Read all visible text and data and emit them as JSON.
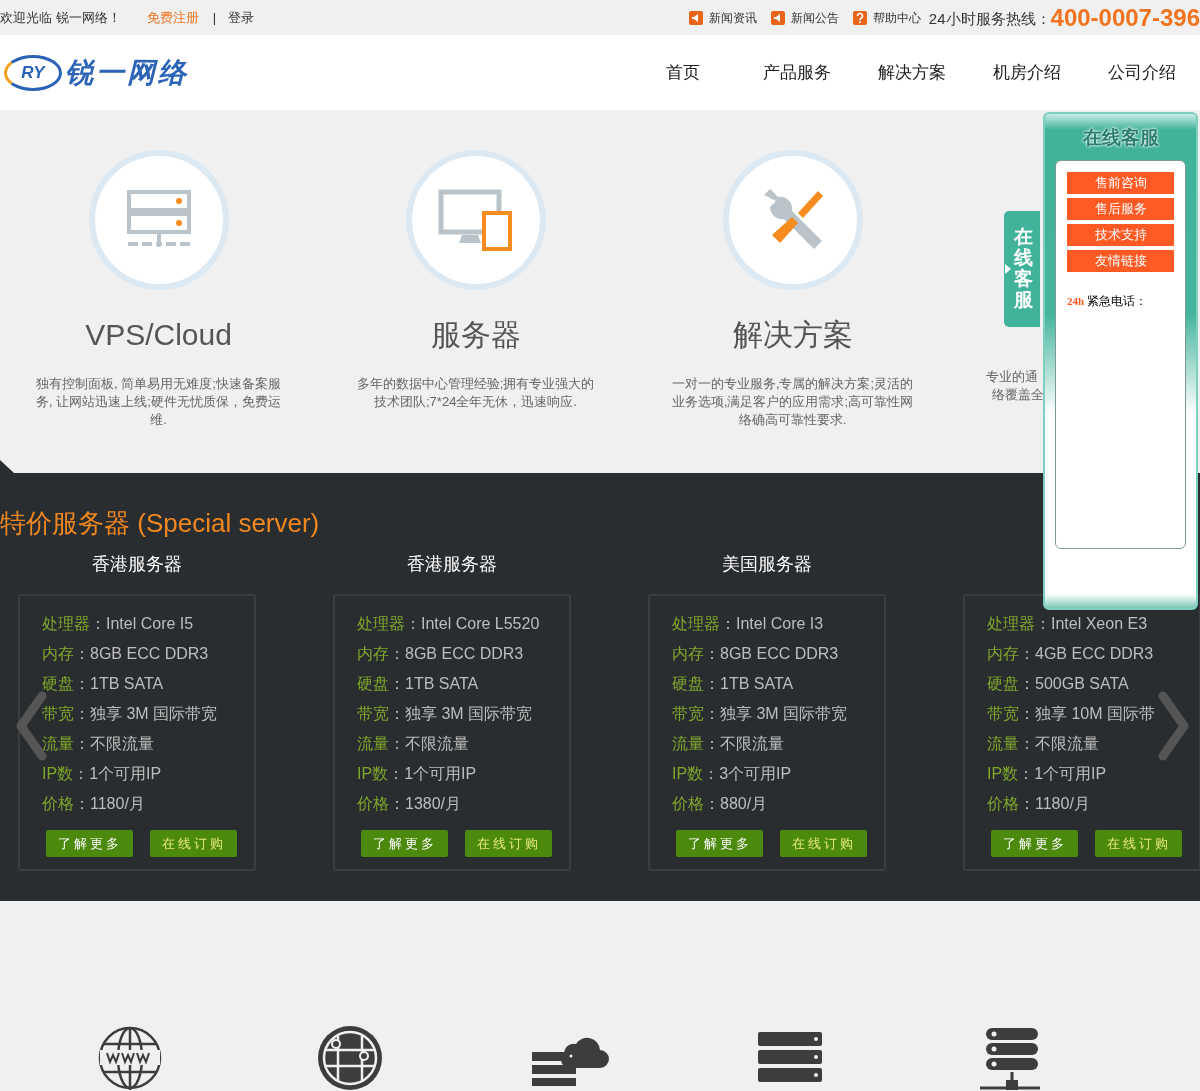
{
  "top_bar": {
    "welcome": "欢迎光临 锐一网络！",
    "register": "免费注册",
    "separator": "|",
    "login": "登录",
    "links": [
      {
        "kind": "news",
        "label": "新闻资讯"
      },
      {
        "kind": "news",
        "label": "新闻公告"
      },
      {
        "kind": "help",
        "label": "帮助中心"
      }
    ],
    "hotline_label": "24小时服务热线：",
    "hotline": "400-0007-396"
  },
  "header": {
    "logo_mark": "RY",
    "logo_text": "锐一网络",
    "nav": [
      "首页",
      "产品服务",
      "解决方案",
      "机房介绍",
      "公司介绍"
    ]
  },
  "features": [
    {
      "kind": "server",
      "title": "VPS/Cloud",
      "description": "独有控制面板, 简单易用无难度;快速备案服务, 让网站迅速上线;硬件无忧质保，免费运维."
    },
    {
      "kind": "devices",
      "title": "服务器",
      "description": "多年的数据中心管理经验;拥有专业强大的技术团队;7*24全年无休，迅速响应."
    },
    {
      "kind": "tools",
      "title": "解决方案",
      "description": "一对一的专业服务,专属的解决方案;灵活的业务选项,满足客户的应用需求;高可靠性网络确高可靠性要求."
    }
  ],
  "feature_fragments": [
    "专业的通",
    "络覆盖全"
  ],
  "special": {
    "title": "特价服务器 (Special server)",
    "separator": "：",
    "servers": [
      {
        "title": "香港服务器",
        "specs": [
          {
            "label": "处理器",
            "value": "Intel Core I5"
          },
          {
            "label": "内存",
            "value": "8GB ECC DDR3"
          },
          {
            "label": "硬盘",
            "value": "1TB SATA"
          },
          {
            "label": "带宽",
            "value": "独享 3M 国际带宽"
          },
          {
            "label": "流量",
            "value": "不限流量"
          },
          {
            "label": "IP数",
            "value": "1个可用IP"
          },
          {
            "label": "价格",
            "value": "1180/月"
          }
        ],
        "buttons": [
          "了解更多",
          "在线订购"
        ]
      },
      {
        "title": "香港服务器",
        "specs": [
          {
            "label": "处理器",
            "value": "Intel Core L5520"
          },
          {
            "label": "内存",
            "value": "8GB ECC DDR3"
          },
          {
            "label": "硬盘",
            "value": "1TB SATA"
          },
          {
            "label": "带宽",
            "value": "独享 3M 国际带宽"
          },
          {
            "label": "流量",
            "value": "不限流量"
          },
          {
            "label": "IP数",
            "value": "1个可用IP"
          },
          {
            "label": "价格",
            "value": "1380/月"
          }
        ],
        "buttons": [
          "了解更多",
          "在线订购"
        ]
      },
      {
        "title": "美国服务器",
        "specs": [
          {
            "label": "处理器",
            "value": "Intel Core I3"
          },
          {
            "label": "内存",
            "value": "8GB ECC DDR3"
          },
          {
            "label": "硬盘",
            "value": "1TB SATA"
          },
          {
            "label": "带宽",
            "value": "独享 3M 国际带宽"
          },
          {
            "label": "流量",
            "value": "不限流量"
          },
          {
            "label": "IP数",
            "value": "3个可用IP"
          },
          {
            "label": "价格",
            "value": "880/月"
          }
        ],
        "buttons": [
          "了解更多",
          "在线订购"
        ]
      },
      {
        "specs": [
          {
            "label": "处理器",
            "value": "Intel Xeon E3"
          },
          {
            "label": "内存",
            "value": "4GB ECC DDR3"
          },
          {
            "label": "硬盘",
            "value": "500GB SATA"
          },
          {
            "label": "带宽",
            "value": "独享 10M 国际带"
          },
          {
            "label": "流量",
            "value": "不限流量"
          },
          {
            "label": "IP数",
            "value": "1个可用IP"
          },
          {
            "label": "价格",
            "value": "1180/月"
          }
        ],
        "buttons": [
          "了解更多",
          "在线订购"
        ]
      }
    ]
  },
  "service_icons": [
    {
      "kind": "www"
    },
    {
      "kind": "network"
    },
    {
      "kind": "cloud"
    },
    {
      "kind": "rack"
    },
    {
      "kind": "hosting"
    }
  ],
  "support_tab": {
    "label": "在线客服"
  },
  "support_panel": {
    "title": "在线客服",
    "buttons": [
      "售前咨询",
      "售后服务",
      "技术支持",
      "友情链接"
    ],
    "hotline_prefix": "24h",
    "hotline_label": "紧急电话："
  }
}
